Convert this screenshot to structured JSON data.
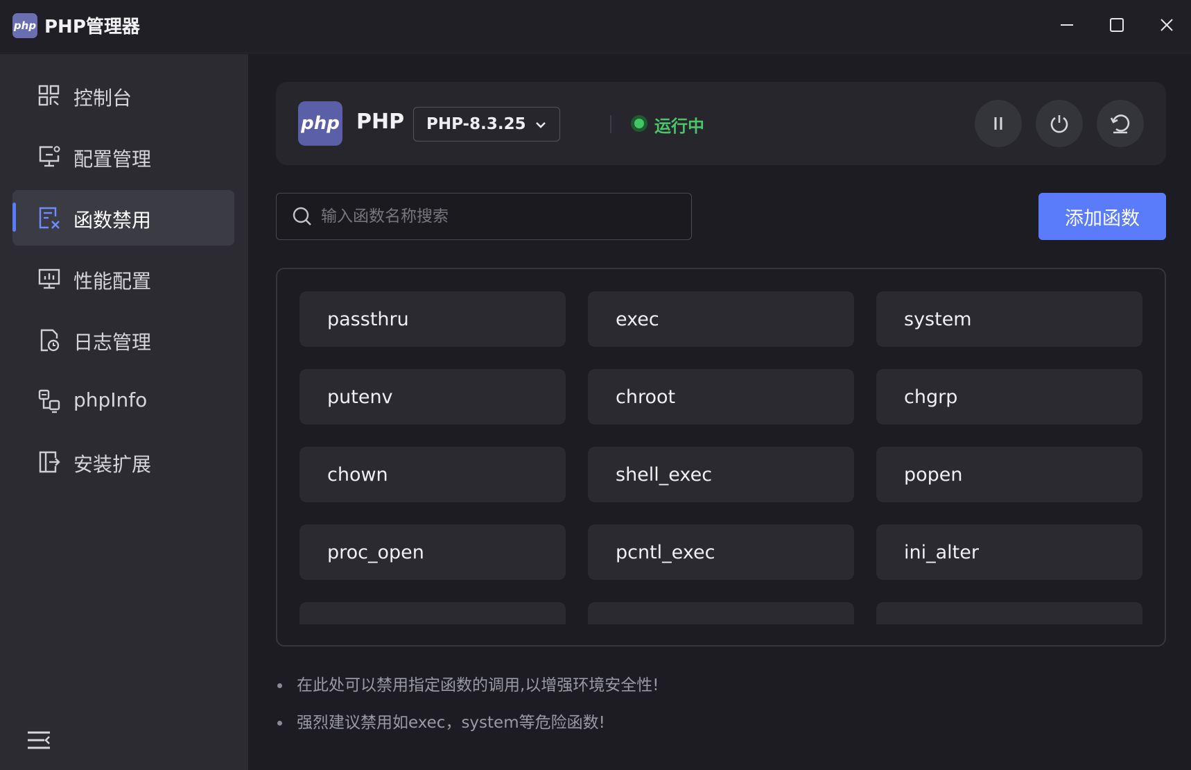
{
  "app": {
    "logo_text": "php",
    "title": "PHP管理器"
  },
  "sidebar": {
    "items": [
      {
        "label": "控制台",
        "icon": "dashboard-icon",
        "active": false
      },
      {
        "label": "配置管理",
        "icon": "config-monitor-icon",
        "active": false
      },
      {
        "label": "函数禁用",
        "icon": "function-disable-icon",
        "active": true
      },
      {
        "label": "性能配置",
        "icon": "performance-icon",
        "active": false
      },
      {
        "label": "日志管理",
        "icon": "log-file-icon",
        "active": false
      },
      {
        "label": "phpInfo",
        "icon": "phpinfo-icon",
        "active": false
      },
      {
        "label": "安装扩展",
        "icon": "install-extension-icon",
        "active": false
      }
    ],
    "menu_toggle_icon": "menu-collapse-icon"
  },
  "php_card": {
    "logo_text": "php",
    "label": "PHP",
    "version": "PHP-8.3.25",
    "status": "运行中",
    "status_color": "#43c766"
  },
  "search": {
    "placeholder": "输入函数名称搜索",
    "value": ""
  },
  "add_button": {
    "label": "添加函数",
    "color": "#5b7cfa"
  },
  "functions": [
    "passthru",
    "exec",
    "system",
    "putenv",
    "chroot",
    "chgrp",
    "chown",
    "shell_exec",
    "popen",
    "proc_open",
    "pcntl_exec",
    "ini_alter"
  ],
  "tips": [
    "在此处可以禁用指定函数的调用,以增强环境安全性!",
    "强烈建议禁用如exec，system等危险函数!"
  ]
}
